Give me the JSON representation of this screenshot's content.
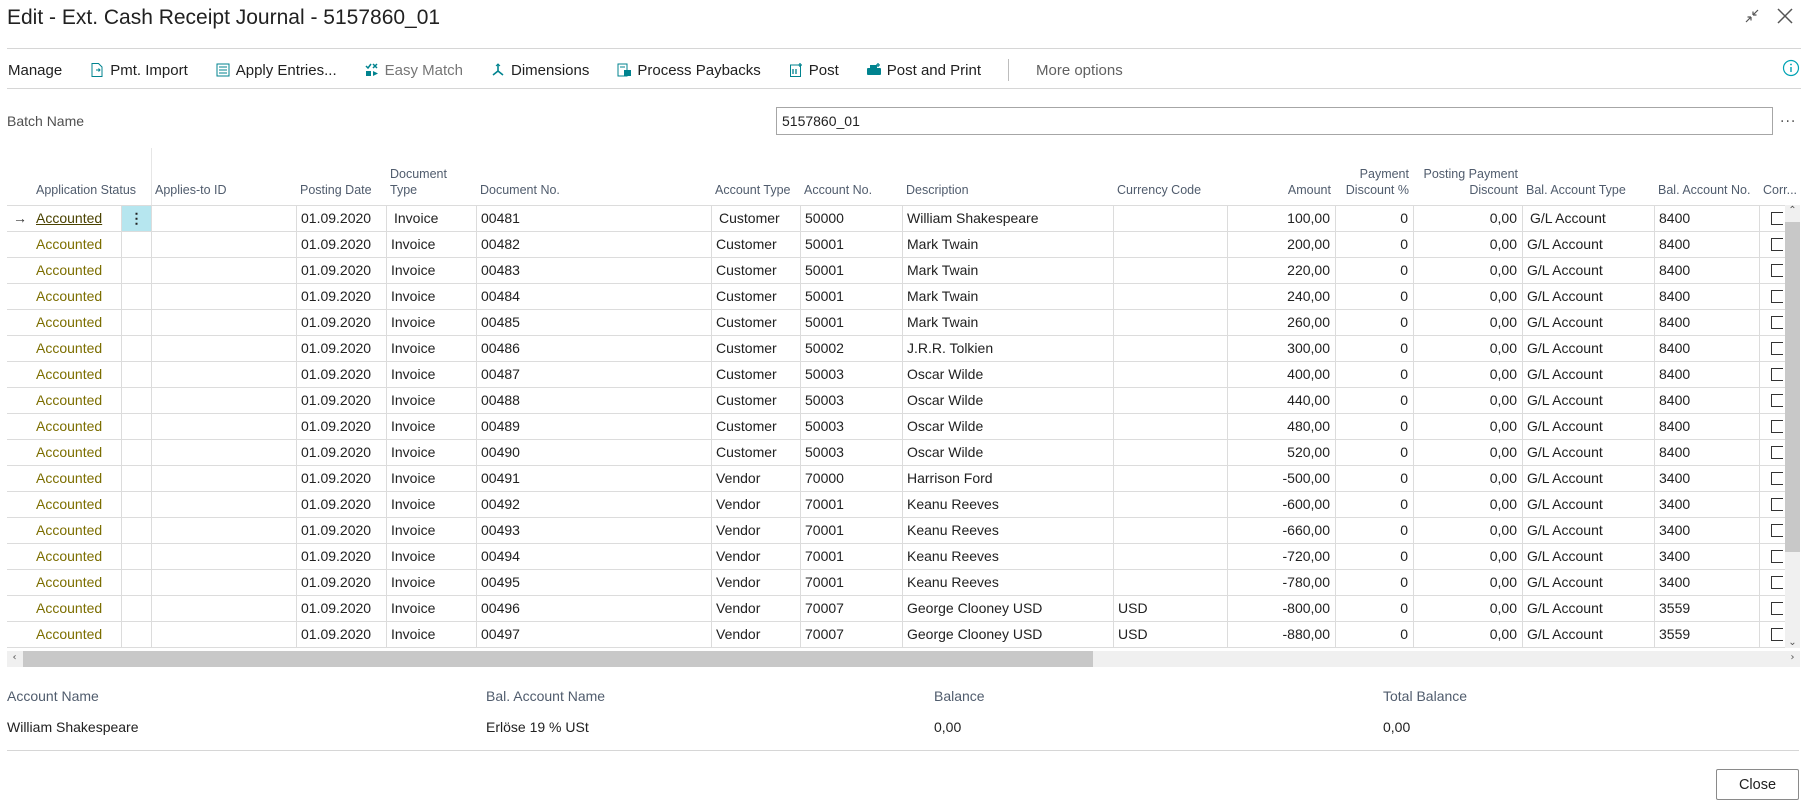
{
  "window": {
    "title": "Edit - Ext. Cash Receipt Journal - 5157860_01",
    "collapse_icon": "collapse-icon",
    "close_icon": "close-icon"
  },
  "toolbar": {
    "items": [
      {
        "label": "Manage",
        "icon": null,
        "disabled": false
      },
      {
        "label": "Pmt. Import",
        "icon": "document-import-icon",
        "disabled": false
      },
      {
        "label": "Apply Entries...",
        "icon": "apply-entries-icon",
        "disabled": false
      },
      {
        "label": "Easy Match",
        "icon": "easy-match-icon",
        "disabled": true
      },
      {
        "label": "Dimensions",
        "icon": "dimensions-icon",
        "disabled": false
      },
      {
        "label": "Process Paybacks",
        "icon": "process-paybacks-icon",
        "disabled": false
      },
      {
        "label": "Post",
        "icon": "post-icon",
        "disabled": false
      },
      {
        "label": "Post and Print",
        "icon": "post-print-icon",
        "disabled": false
      }
    ],
    "more_options": "More options",
    "info_icon": "info-icon",
    "accent": "#00a3b4"
  },
  "batch": {
    "label": "Batch Name",
    "value": "5157860_01",
    "more": "..."
  },
  "grid": {
    "columns": [
      {
        "key": "status",
        "label": "Application Status"
      },
      {
        "key": "applies_to_id",
        "label": "Applies-to ID"
      },
      {
        "key": "posting_date",
        "label": "Posting Date"
      },
      {
        "key": "doc_type",
        "label": "Document Type"
      },
      {
        "key": "doc_no",
        "label": "Document No."
      },
      {
        "key": "account_type",
        "label": "Account Type"
      },
      {
        "key": "account_no",
        "label": "Account No."
      },
      {
        "key": "description",
        "label": "Description"
      },
      {
        "key": "currency",
        "label": "Currency Code"
      },
      {
        "key": "amount",
        "label": "Amount"
      },
      {
        "key": "pmt_disc_pct",
        "label": "Payment Discount %"
      },
      {
        "key": "posting_pmt_disc",
        "label": "Posting Payment Discount"
      },
      {
        "key": "bal_account_type",
        "label": "Bal. Account Type"
      },
      {
        "key": "bal_account_no",
        "label": "Bal. Account No."
      },
      {
        "key": "corr",
        "label": "Corr..."
      }
    ],
    "selected_row": 0,
    "status_color": "#7c6e00",
    "rows": [
      {
        "status": "Accounted",
        "applies_to_id": "",
        "posting_date": "01.09.2020",
        "doc_type": "Invoice",
        "doc_no": "00481",
        "account_type": "Customer",
        "account_no": "50000",
        "description": "William Shakespeare",
        "currency": "",
        "amount": "100,00",
        "pmt_disc_pct": "0",
        "posting_pmt_disc": "0,00",
        "bal_account_type": "G/L Account",
        "bal_account_no": "8400",
        "corr": false
      },
      {
        "status": "Accounted",
        "applies_to_id": "",
        "posting_date": "01.09.2020",
        "doc_type": "Invoice",
        "doc_no": "00482",
        "account_type": "Customer",
        "account_no": "50001",
        "description": "Mark Twain",
        "currency": "",
        "amount": "200,00",
        "pmt_disc_pct": "0",
        "posting_pmt_disc": "0,00",
        "bal_account_type": "G/L Account",
        "bal_account_no": "8400",
        "corr": false
      },
      {
        "status": "Accounted",
        "applies_to_id": "",
        "posting_date": "01.09.2020",
        "doc_type": "Invoice",
        "doc_no": "00483",
        "account_type": "Customer",
        "account_no": "50001",
        "description": "Mark Twain",
        "currency": "",
        "amount": "220,00",
        "pmt_disc_pct": "0",
        "posting_pmt_disc": "0,00",
        "bal_account_type": "G/L Account",
        "bal_account_no": "8400",
        "corr": false
      },
      {
        "status": "Accounted",
        "applies_to_id": "",
        "posting_date": "01.09.2020",
        "doc_type": "Invoice",
        "doc_no": "00484",
        "account_type": "Customer",
        "account_no": "50001",
        "description": "Mark Twain",
        "currency": "",
        "amount": "240,00",
        "pmt_disc_pct": "0",
        "posting_pmt_disc": "0,00",
        "bal_account_type": "G/L Account",
        "bal_account_no": "8400",
        "corr": false
      },
      {
        "status": "Accounted",
        "applies_to_id": "",
        "posting_date": "01.09.2020",
        "doc_type": "Invoice",
        "doc_no": "00485",
        "account_type": "Customer",
        "account_no": "50001",
        "description": "Mark Twain",
        "currency": "",
        "amount": "260,00",
        "pmt_disc_pct": "0",
        "posting_pmt_disc": "0,00",
        "bal_account_type": "G/L Account",
        "bal_account_no": "8400",
        "corr": false
      },
      {
        "status": "Accounted",
        "applies_to_id": "",
        "posting_date": "01.09.2020",
        "doc_type": "Invoice",
        "doc_no": "00486",
        "account_type": "Customer",
        "account_no": "50002",
        "description": "J.R.R. Tolkien",
        "currency": "",
        "amount": "300,00",
        "pmt_disc_pct": "0",
        "posting_pmt_disc": "0,00",
        "bal_account_type": "G/L Account",
        "bal_account_no": "8400",
        "corr": false
      },
      {
        "status": "Accounted",
        "applies_to_id": "",
        "posting_date": "01.09.2020",
        "doc_type": "Invoice",
        "doc_no": "00487",
        "account_type": "Customer",
        "account_no": "50003",
        "description": "Oscar Wilde",
        "currency": "",
        "amount": "400,00",
        "pmt_disc_pct": "0",
        "posting_pmt_disc": "0,00",
        "bal_account_type": "G/L Account",
        "bal_account_no": "8400",
        "corr": false
      },
      {
        "status": "Accounted",
        "applies_to_id": "",
        "posting_date": "01.09.2020",
        "doc_type": "Invoice",
        "doc_no": "00488",
        "account_type": "Customer",
        "account_no": "50003",
        "description": "Oscar Wilde",
        "currency": "",
        "amount": "440,00",
        "pmt_disc_pct": "0",
        "posting_pmt_disc": "0,00",
        "bal_account_type": "G/L Account",
        "bal_account_no": "8400",
        "corr": false
      },
      {
        "status": "Accounted",
        "applies_to_id": "",
        "posting_date": "01.09.2020",
        "doc_type": "Invoice",
        "doc_no": "00489",
        "account_type": "Customer",
        "account_no": "50003",
        "description": "Oscar Wilde",
        "currency": "",
        "amount": "480,00",
        "pmt_disc_pct": "0",
        "posting_pmt_disc": "0,00",
        "bal_account_type": "G/L Account",
        "bal_account_no": "8400",
        "corr": false
      },
      {
        "status": "Accounted",
        "applies_to_id": "",
        "posting_date": "01.09.2020",
        "doc_type": "Invoice",
        "doc_no": "00490",
        "account_type": "Customer",
        "account_no": "50003",
        "description": "Oscar Wilde",
        "currency": "",
        "amount": "520,00",
        "pmt_disc_pct": "0",
        "posting_pmt_disc": "0,00",
        "bal_account_type": "G/L Account",
        "bal_account_no": "8400",
        "corr": false
      },
      {
        "status": "Accounted",
        "applies_to_id": "",
        "posting_date": "01.09.2020",
        "doc_type": "Invoice",
        "doc_no": "00491",
        "account_type": "Vendor",
        "account_no": "70000",
        "description": "Harrison Ford",
        "currency": "",
        "amount": "-500,00",
        "pmt_disc_pct": "0",
        "posting_pmt_disc": "0,00",
        "bal_account_type": "G/L Account",
        "bal_account_no": "3400",
        "corr": false
      },
      {
        "status": "Accounted",
        "applies_to_id": "",
        "posting_date": "01.09.2020",
        "doc_type": "Invoice",
        "doc_no": "00492",
        "account_type": "Vendor",
        "account_no": "70001",
        "description": "Keanu Reeves",
        "currency": "",
        "amount": "-600,00",
        "pmt_disc_pct": "0",
        "posting_pmt_disc": "0,00",
        "bal_account_type": "G/L Account",
        "bal_account_no": "3400",
        "corr": false
      },
      {
        "status": "Accounted",
        "applies_to_id": "",
        "posting_date": "01.09.2020",
        "doc_type": "Invoice",
        "doc_no": "00493",
        "account_type": "Vendor",
        "account_no": "70001",
        "description": "Keanu Reeves",
        "currency": "",
        "amount": "-660,00",
        "pmt_disc_pct": "0",
        "posting_pmt_disc": "0,00",
        "bal_account_type": "G/L Account",
        "bal_account_no": "3400",
        "corr": false
      },
      {
        "status": "Accounted",
        "applies_to_id": "",
        "posting_date": "01.09.2020",
        "doc_type": "Invoice",
        "doc_no": "00494",
        "account_type": "Vendor",
        "account_no": "70001",
        "description": "Keanu Reeves",
        "currency": "",
        "amount": "-720,00",
        "pmt_disc_pct": "0",
        "posting_pmt_disc": "0,00",
        "bal_account_type": "G/L Account",
        "bal_account_no": "3400",
        "corr": false
      },
      {
        "status": "Accounted",
        "applies_to_id": "",
        "posting_date": "01.09.2020",
        "doc_type": "Invoice",
        "doc_no": "00495",
        "account_type": "Vendor",
        "account_no": "70001",
        "description": "Keanu Reeves",
        "currency": "",
        "amount": "-780,00",
        "pmt_disc_pct": "0",
        "posting_pmt_disc": "0,00",
        "bal_account_type": "G/L Account",
        "bal_account_no": "3400",
        "corr": false
      },
      {
        "status": "Accounted",
        "applies_to_id": "",
        "posting_date": "01.09.2020",
        "doc_type": "Invoice",
        "doc_no": "00496",
        "account_type": "Vendor",
        "account_no": "70007",
        "description": "George Clooney USD",
        "currency": "USD",
        "amount": "-800,00",
        "pmt_disc_pct": "0",
        "posting_pmt_disc": "0,00",
        "bal_account_type": "G/L Account",
        "bal_account_no": "3559",
        "corr": false
      },
      {
        "status": "Accounted",
        "applies_to_id": "",
        "posting_date": "01.09.2020",
        "doc_type": "Invoice",
        "doc_no": "00497",
        "account_type": "Vendor",
        "account_no": "70007",
        "description": "George Clooney USD",
        "currency": "USD",
        "amount": "-880,00",
        "pmt_disc_pct": "0",
        "posting_pmt_disc": "0,00",
        "bal_account_type": "G/L Account",
        "bal_account_no": "3559",
        "corr": false
      }
    ]
  },
  "footer": {
    "account_name_label": "Account Name",
    "account_name_value": "William Shakespeare",
    "bal_account_name_label": "Bal. Account Name",
    "bal_account_name_value": "Erlöse 19 % USt",
    "balance_label": "Balance",
    "balance_value": "0,00",
    "total_balance_label": "Total Balance",
    "total_balance_value": "0,00"
  },
  "close_button": "Close"
}
